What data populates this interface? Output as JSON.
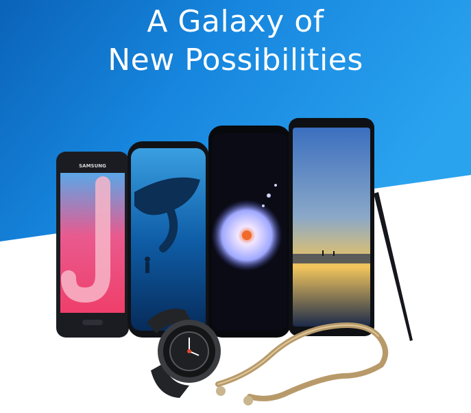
{
  "banner": {
    "headline_line1": "A Galaxy of",
    "headline_line2": "New Possibilities",
    "phone_brand_label": "SAMSUNG",
    "colors": {
      "sky_blue": "#1f93e6",
      "deep_blue": "#0b5eb0",
      "text": "#ffffff"
    }
  }
}
